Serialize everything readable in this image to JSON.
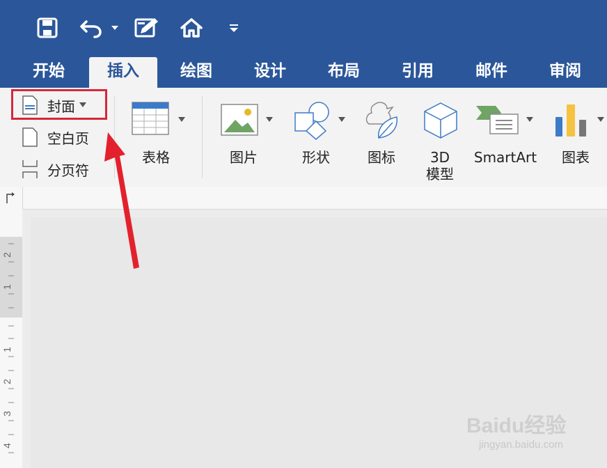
{
  "quick_access": {
    "icons": [
      "save-icon",
      "undo-icon",
      "undo-dropdown-icon",
      "edit-doc-icon",
      "home-icon",
      "customize-dropdown-icon"
    ]
  },
  "tabs": [
    {
      "label": "开始",
      "active": false
    },
    {
      "label": "插入",
      "active": true
    },
    {
      "label": "绘图",
      "active": false
    },
    {
      "label": "设计",
      "active": false
    },
    {
      "label": "布局",
      "active": false
    },
    {
      "label": "引用",
      "active": false
    },
    {
      "label": "邮件",
      "active": false
    },
    {
      "label": "审阅",
      "active": false
    }
  ],
  "ribbon": {
    "pages": {
      "cover": "封面",
      "blank": "空白页",
      "page_break": "分页符"
    },
    "table": "表格",
    "picture": "图片",
    "shape": "形状",
    "icon": "图标",
    "model_3d_line1": "3D",
    "model_3d_line2": "模型",
    "smartart": "SmartArt",
    "chart": "图表"
  },
  "ruler": {
    "vertical_labels": [
      "2",
      "1",
      "1",
      "2",
      "3",
      "4"
    ]
  },
  "watermark": {
    "brand": "Baidu经验",
    "url": "jingyan.baidu.com"
  },
  "colors": {
    "accent": "#2b579a",
    "highlight": "#d4283a",
    "arrow": "#e3212d"
  }
}
